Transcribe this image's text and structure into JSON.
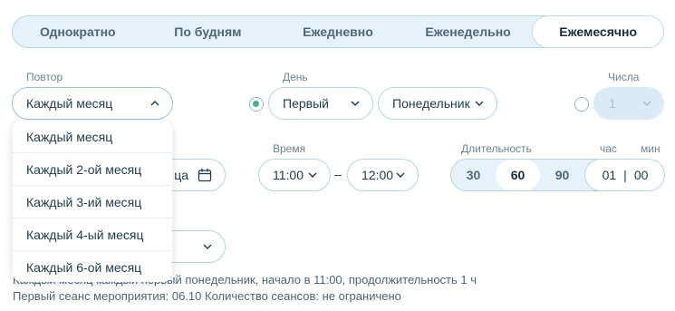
{
  "tabs": [
    {
      "label": "Однократно",
      "active": false
    },
    {
      "label": "По будням",
      "active": false
    },
    {
      "label": "Ежедневно",
      "active": false
    },
    {
      "label": "Еженедельно",
      "active": false
    },
    {
      "label": "Ежемесячно",
      "active": true
    }
  ],
  "repeat": {
    "label": "Повтор",
    "value": "Каждый месяц"
  },
  "day": {
    "label": "День",
    "ordinal": "Первый",
    "weekday": "Понедельник"
  },
  "dates": {
    "label": "Числа",
    "value": "1"
  },
  "end_field": {
    "partial_text": "ца"
  },
  "time": {
    "label": "Время",
    "start": "11:00",
    "separator": "–",
    "end": "12:00"
  },
  "duration": {
    "label": "Длительность",
    "hours_label": "час",
    "minutes_label": "мин",
    "options": [
      "30",
      "60",
      "90"
    ],
    "selected": "60",
    "hours": "01",
    "separator": "|",
    "minutes": "00"
  },
  "dropdown": {
    "items": [
      "Каждый месяц",
      "Каждый 2-ой месяц",
      "Каждый 3-ий месяц",
      "Каждый 4-ый месяц",
      "Каждый 6-ой месяц"
    ]
  },
  "summary": {
    "line1": "Каждый месяц каждый первый понедельник, начало в 11:00, продолжительность 1 ч",
    "line2": "Первый сеанс мероприятия: 06.10 Количество сеансов: не ограничено"
  },
  "colors": {
    "accent": "#3fb48c",
    "border": "#b8d3e6",
    "segment_bg": "#e7f1f9"
  }
}
